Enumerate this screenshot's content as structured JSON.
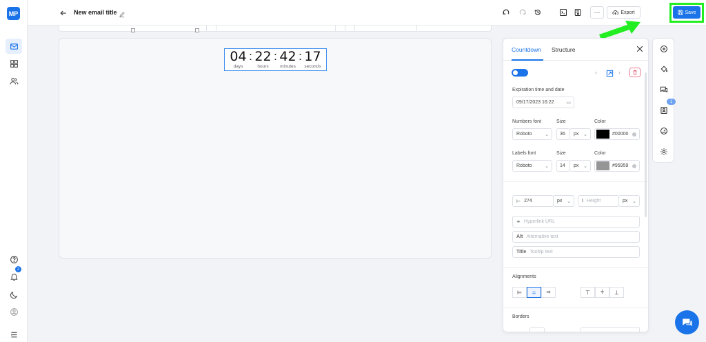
{
  "app": {
    "logo": "MP"
  },
  "leftRail": {
    "icons": [
      "mail-icon",
      "layout-icon",
      "contacts-icon",
      "help-icon",
      "bell-icon",
      "moon-icon",
      "avatar",
      "menu-icon"
    ],
    "notificationCount": "2"
  },
  "header": {
    "title": "New email title",
    "more_label": "···",
    "export_label": "Export",
    "save_label": "Save",
    "highlight_color": "#22ee22"
  },
  "timer": {
    "days": "04",
    "hours": "22",
    "minutes": "42",
    "seconds": "17",
    "sep": ":",
    "days_label": "days",
    "hours_label": "hours",
    "minutes_label": "minutes",
    "seconds_label": "seconds"
  },
  "panel": {
    "tabs": [
      "Countdown",
      "Structure"
    ],
    "expiration_label": "Expiration time and date",
    "expiration_value": "09/17/2023 16:22",
    "numbers_font_label": "Numbers font",
    "numbers_font": "Roboto",
    "numbers_size": "36",
    "numbers_unit": "px",
    "numbers_color": "#00000",
    "numbers_color_hex": "#000000",
    "size_label": "Size",
    "color_label": "Color",
    "labels_font_label": "Labels font",
    "labels_font": "Roboto",
    "labels_size": "14",
    "labels_unit": "px",
    "labels_color": "#95959",
    "labels_color_hex": "#959595",
    "width_value": "274",
    "width_unit": "px",
    "height_placeholder": "Height",
    "height_unit": "px",
    "hyperlink_placeholder": "Hyperlink URL",
    "alt_prefix": "Alt",
    "alt_placeholder": "Alternative text",
    "title_prefix": "Title",
    "title_placeholder": "Tooltip text",
    "alignments_label": "Alignments",
    "borders_label": "Borders"
  },
  "toolRail": {
    "badge": "1"
  }
}
